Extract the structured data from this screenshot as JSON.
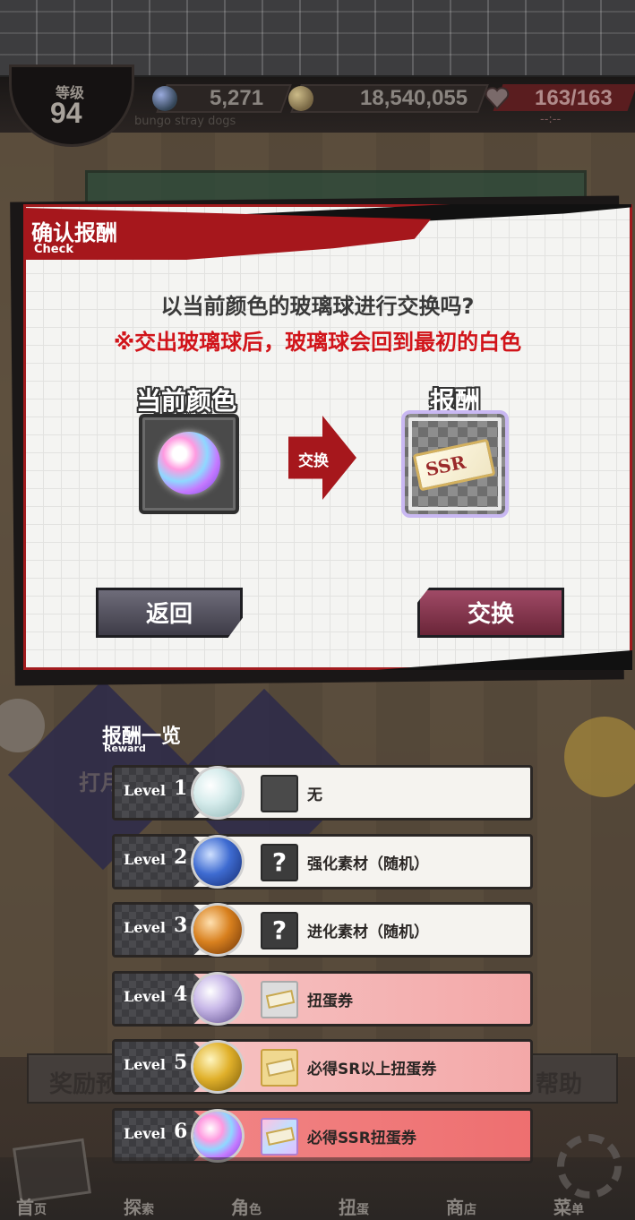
{
  "header": {
    "level_label": "等级",
    "level_value": "94",
    "crystal_count": "5,271",
    "coin_count": "18,540,055",
    "stamina": "163/163",
    "stamina_timer": "--:--",
    "game_subtitle": "bungo stray dogs"
  },
  "dialog": {
    "title": "确认报酬",
    "title_sub": "Check",
    "question": "以当前颜色的玻璃球进行交换吗?",
    "warning": "※交出玻璃球后，玻璃球会回到最初的白色",
    "current_label": "当前颜色",
    "reward_label": "报酬",
    "arrow_label": "交换",
    "ticket_text": "SSR",
    "back_button": "返回",
    "exchange_button": "交换"
  },
  "reward_list": {
    "title": "报酬一览",
    "subtitle": "Reward",
    "level_word": "Level",
    "rows": [
      {
        "level": "1",
        "reward": "无",
        "style": "plain",
        "icon": "empty-icon"
      },
      {
        "level": "2",
        "reward": "强化素材（随机）",
        "style": "plain",
        "icon": "question-icon"
      },
      {
        "level": "3",
        "reward": "进化素材（随机）",
        "style": "plain",
        "icon": "question-icon"
      },
      {
        "level": "4",
        "reward": "扭蛋券",
        "style": "pink",
        "icon": "ticket-icon"
      },
      {
        "level": "5",
        "reward": "必得SR以上扭蛋券",
        "style": "pink",
        "icon": "ticket-sr-icon"
      },
      {
        "level": "6",
        "reward": "必得SSR扭蛋券",
        "style": "red",
        "icon": "ticket-ssr-icon"
      }
    ],
    "question_mark": "?"
  },
  "background": {
    "left_button": "奖励预",
    "right_button": "帮助",
    "stage_text": "打月"
  },
  "nav": {
    "items": [
      {
        "main": "首",
        "sub": "页"
      },
      {
        "main": "探",
        "sub": "索"
      },
      {
        "main": "角",
        "sub": "色"
      },
      {
        "main": "扭",
        "sub": "蛋"
      },
      {
        "main": "商",
        "sub": "店"
      },
      {
        "main": "菜",
        "sub": "单"
      }
    ]
  },
  "colors": {
    "accent_red": "#a6171c",
    "warning_red": "#d1141a",
    "exchange_button": "#8a3550",
    "back_button": "#56545f"
  }
}
